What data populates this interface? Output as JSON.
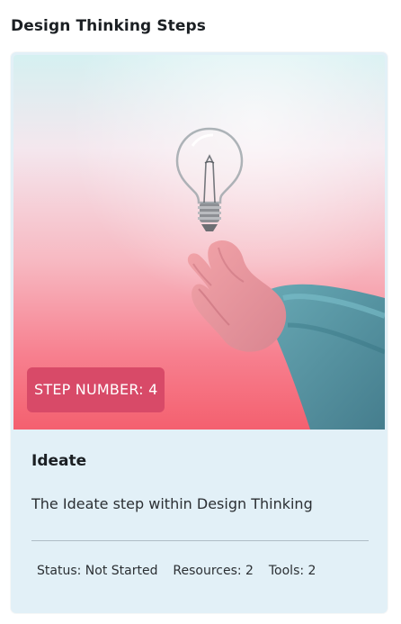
{
  "page": {
    "title": "Design Thinking Steps"
  },
  "card": {
    "badge_label": "STEP NUMBER:",
    "step_number": "4",
    "step_name": "Ideate",
    "description": "The Ideate step within Design Thinking",
    "status_label": "Status:",
    "status_value": "Not Started",
    "resources_label": "Resources:",
    "resources_value": "2",
    "tools_label": "Tools:",
    "tools_value": "2"
  },
  "colors": {
    "card_background": "#e2f0f7",
    "badge_background": "#d84a68",
    "badge_text": "#ffffff"
  },
  "image": {
    "subject": "hand-holding-lightbulb"
  }
}
